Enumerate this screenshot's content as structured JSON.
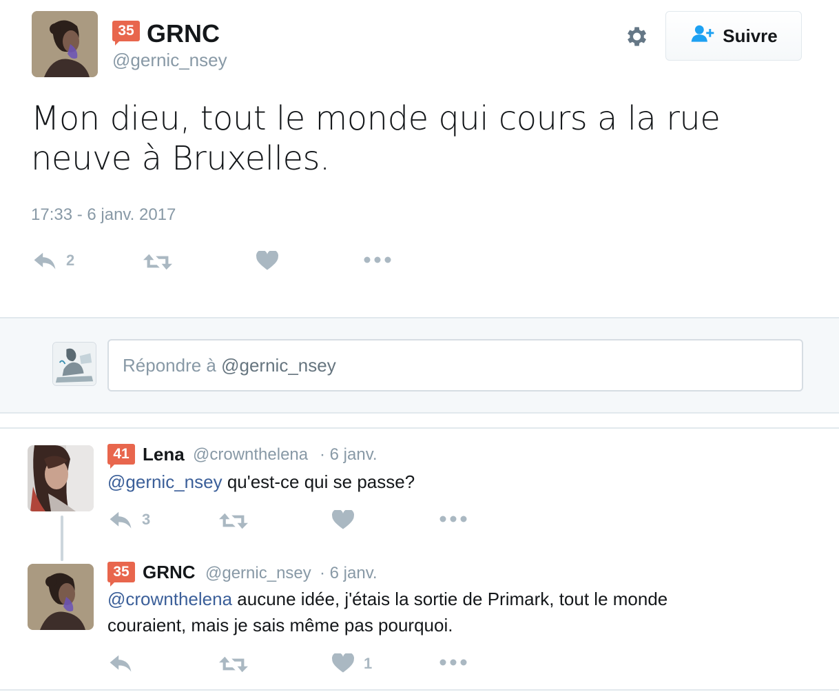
{
  "main_tweet": {
    "badge": "35",
    "display_name": "GRNC",
    "handle": "@gernic_nsey",
    "text": "Mon dieu, tout le monde qui cours a la rue neuve à Bruxelles.",
    "timestamp": "17:33 - 6 janv. 2017",
    "follow_label": "Suivre",
    "reply_count": "2",
    "icons": [
      "gear-icon",
      "add-user-icon",
      "reply-icon",
      "retweet-icon",
      "heart-icon",
      "more-icon"
    ]
  },
  "reply_box": {
    "prefix": "Répondre à ",
    "mention": "@gernic_nsey"
  },
  "replies": [
    {
      "badge": "41",
      "display_name": "Lena",
      "handle": "@crownthelena",
      "date": "· 6 janv.",
      "mention": "@gernic_nsey",
      "text": " qu'est-ce qui se passe?",
      "reply_count": "3",
      "like_count": ""
    },
    {
      "badge": "35",
      "display_name": "GRNC",
      "handle": "@gernic_nsey",
      "date": "· 6 janv.",
      "mention": "@crownthelena",
      "text": " aucune idée, j'étais  la sortie de Primark, tout le monde couraient, mais je sais même pas pourquoi.",
      "reply_count": "",
      "like_count": "1"
    }
  ],
  "colors": {
    "badge": "#e8664d",
    "link": "#3b5f99",
    "muted": "#8899a6",
    "icon": "#aab8c2",
    "follow_icon": "#1da1f2"
  }
}
